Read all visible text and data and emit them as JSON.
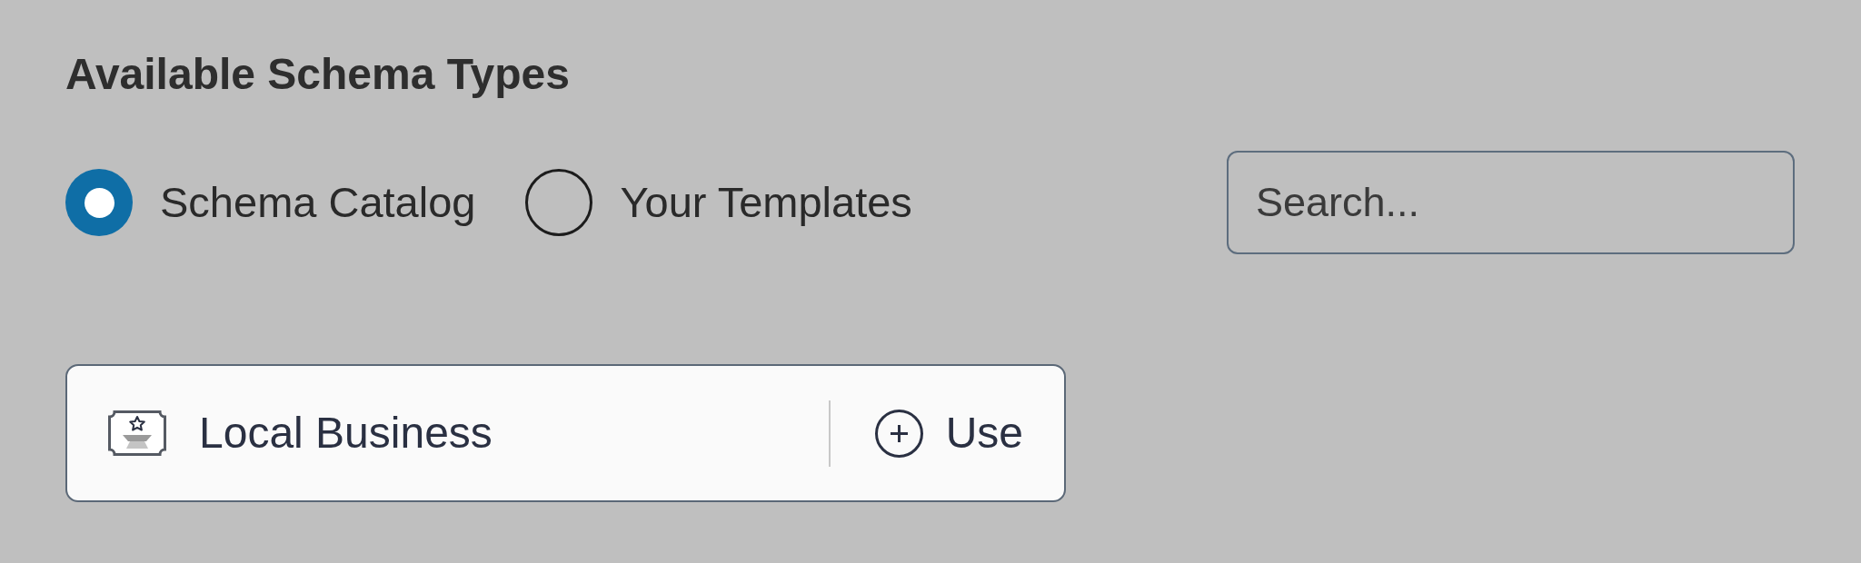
{
  "section": {
    "title": "Available Schema Types"
  },
  "source_options": [
    {
      "label": "Schema Catalog",
      "selected": true
    },
    {
      "label": "Your Templates",
      "selected": false
    }
  ],
  "search": {
    "placeholder": "Search..."
  },
  "schema_types": [
    {
      "name": "Local Business",
      "action": "Use"
    }
  ]
}
